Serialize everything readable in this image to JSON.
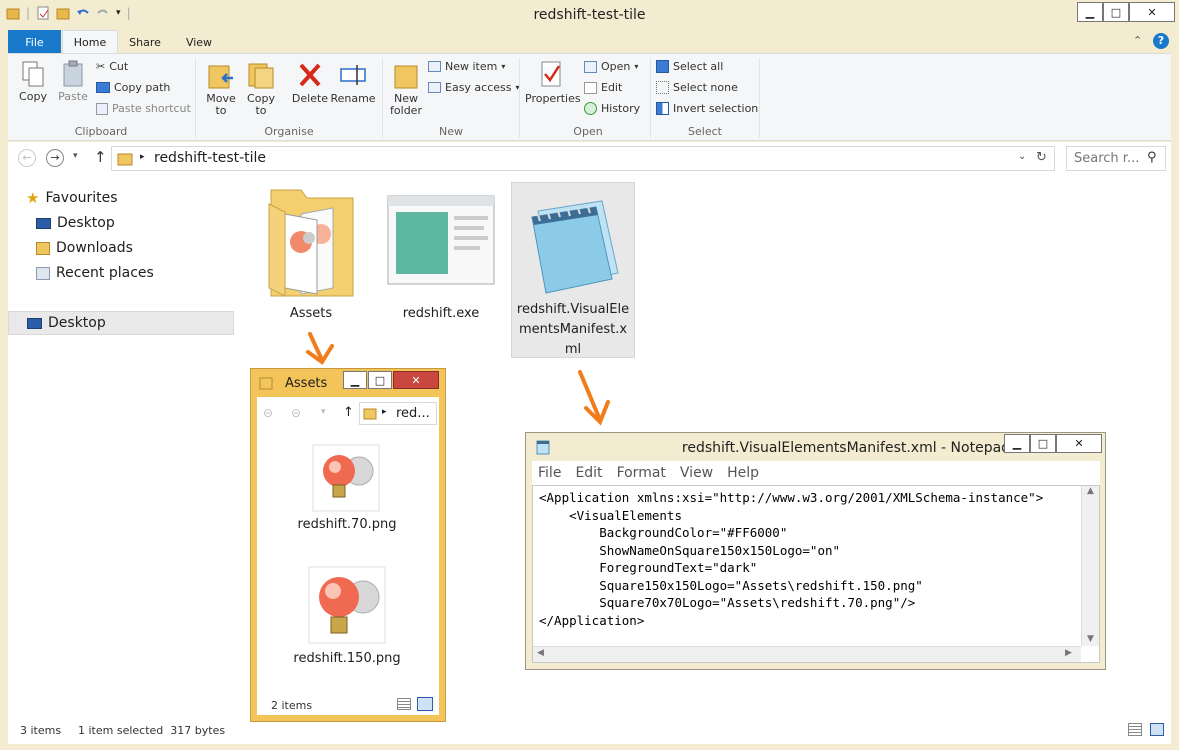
{
  "window": {
    "title": "redshift-test-tile",
    "minimize": "▁",
    "maximize": "□",
    "close": "✕"
  },
  "ribbon": {
    "tabs": [
      "File",
      "Home",
      "Share",
      "View"
    ],
    "clipboard": {
      "copy": "Copy",
      "paste": "Paste",
      "cut": "Cut",
      "copy_path": "Copy path",
      "paste_shortcut": "Paste shortcut",
      "label": "Clipboard"
    },
    "organise": {
      "move_to": "Move to",
      "copy_to": "Copy to",
      "delete": "Delete",
      "rename": "Rename",
      "label": "Organise"
    },
    "new": {
      "new_folder": "New folder",
      "new_item": "New item",
      "easy_access": "Easy access",
      "label": "New"
    },
    "open": {
      "properties": "Properties",
      "open": "Open",
      "edit": "Edit",
      "history": "History",
      "label": "Open"
    },
    "select": {
      "select_all": "Select all",
      "select_none": "Select none",
      "invert": "Invert selection",
      "label": "Select"
    }
  },
  "address": {
    "path": "redshift-test-tile",
    "search_placeholder": "Search r..."
  },
  "nav": {
    "favourites": "Favourites",
    "items": [
      "Desktop",
      "Downloads",
      "Recent places"
    ],
    "desktop_root": "Desktop"
  },
  "files": [
    {
      "name": "Assets"
    },
    {
      "name": "redshift.exe"
    },
    {
      "name_lines": [
        "redshift.VisualEle",
        "mentsManifest.x",
        "ml"
      ]
    }
  ],
  "status": {
    "items": "3 items",
    "selected": "1 item selected  317 bytes"
  },
  "assets_window": {
    "title": "Assets",
    "path": "red...",
    "files": [
      "redshift.70.png",
      "redshift.150.png"
    ],
    "status": "2 items"
  },
  "notepad": {
    "title": "redshift.VisualElementsManifest.xml - Notepad",
    "menu": [
      "File",
      "Edit",
      "Format",
      "View",
      "Help"
    ],
    "lines": [
      "<Application xmlns:xsi=\"http://www.w3.org/2001/XMLSchema-instance\">",
      "    <VisualElements",
      "        BackgroundColor=\"#FF6000\"",
      "        ShowNameOnSquare150x150Logo=\"on\"",
      "        ForegroundText=\"dark\"",
      "        Square150x150Logo=\"Assets\\redshift.150.png\"",
      "        Square70x70Logo=\"Assets\\redshift.70.png\"/>",
      "</Application>"
    ]
  },
  "colors": {
    "accent": "#1979ca",
    "frame": "#f4ecd0",
    "assets_frame": "#f3c45a",
    "arrow": "#f07c1c",
    "selection": "#e5f3fb"
  }
}
